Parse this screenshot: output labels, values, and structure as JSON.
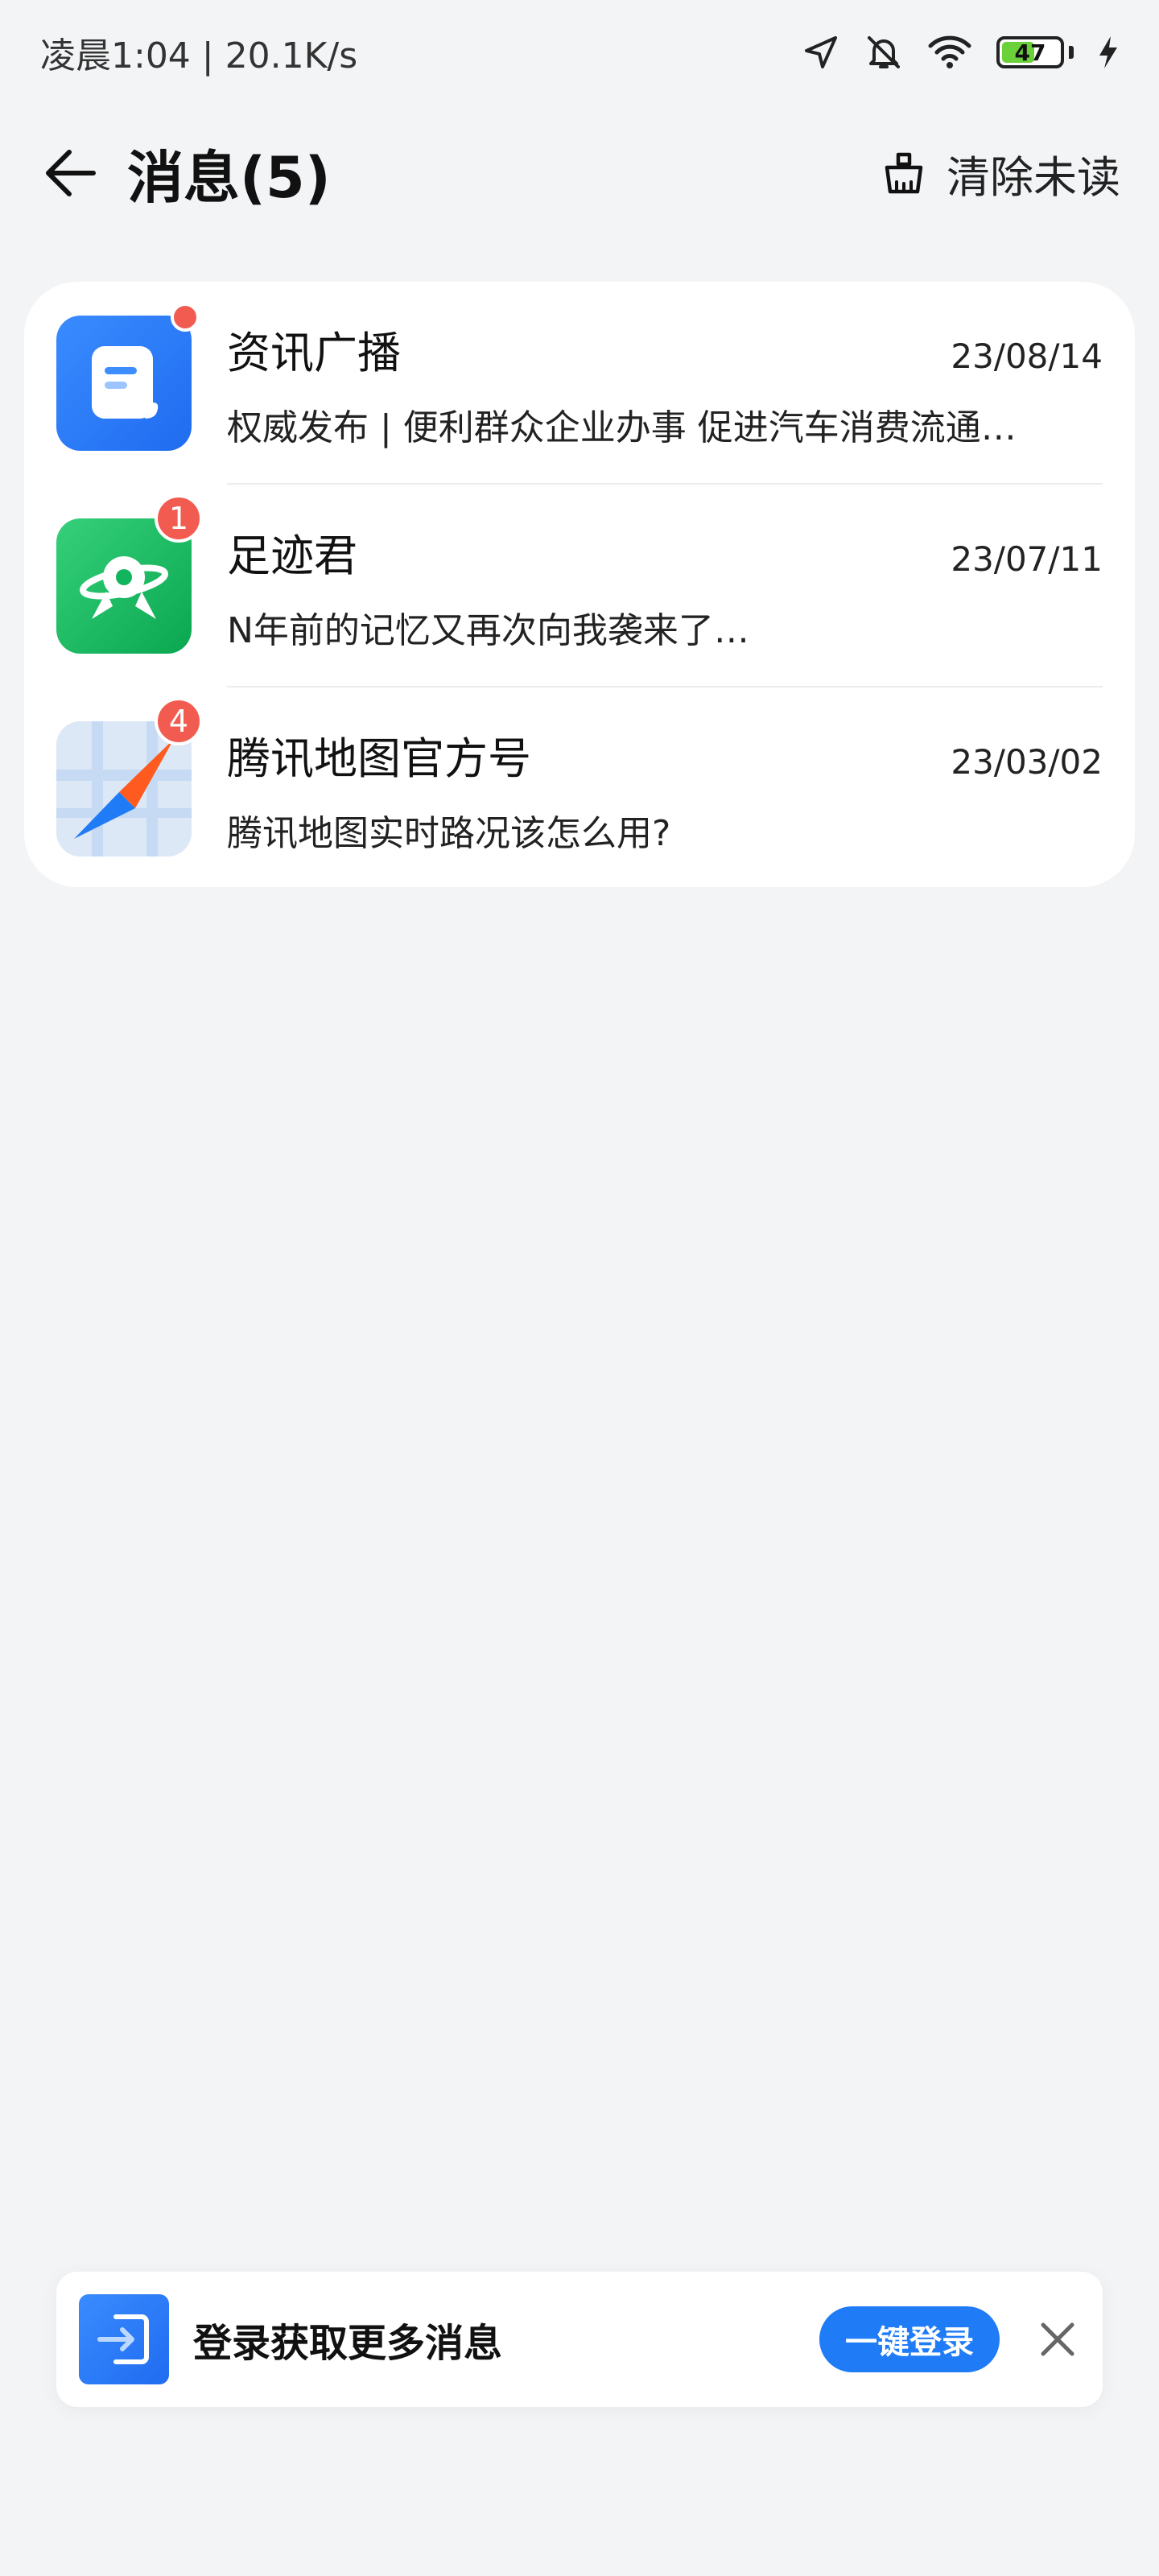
{
  "status_bar": {
    "time_speed": "凌晨1:04 | 20.1K/s",
    "battery_level": "47",
    "icons": [
      "location-icon",
      "bell-muted-icon",
      "wifi-icon",
      "battery-icon",
      "charging-icon"
    ]
  },
  "header": {
    "title": "消息(5)",
    "clear_unread_label": "清除未读"
  },
  "messages": [
    {
      "name": "资讯广播",
      "date": "23/08/14",
      "preview": "权威发布 | 便利群众企业办事 促进汽车消费流通…",
      "unread": "dot",
      "icon": "document-icon",
      "color": "#2a7cf8"
    },
    {
      "name": "足迹君",
      "date": "23/07/11",
      "preview": "N年前的记忆又再次向我袭来了…",
      "badge": "1",
      "icon": "planet-icon",
      "color": "#13b45e"
    },
    {
      "name": "腾讯地图官方号",
      "date": "23/03/02",
      "preview": "腾讯地图实时路况该怎么用?",
      "badge": "4",
      "icon": "compass-map-icon",
      "color": "#ff5a1f"
    }
  ],
  "login_banner": {
    "text": "登录获取更多消息",
    "button_label": "一键登录"
  },
  "colors": {
    "background": "#f3f4f6",
    "accent": "#1f7bf6",
    "badge": "#f25b4f"
  }
}
